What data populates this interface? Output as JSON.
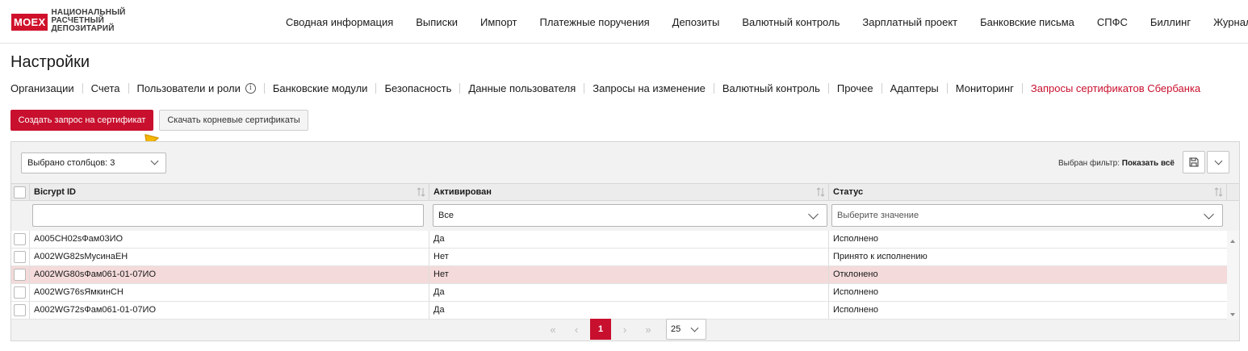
{
  "brand": {
    "logo_mark": "MOEX",
    "logo_line1": "НАЦИОНАЛЬНЫЙ",
    "logo_line2": "РАСЧЕТНЫЙ",
    "logo_line3": "ДЕПОЗИТАРИЙ",
    "accent_color": "#c8102e"
  },
  "nav": {
    "items": [
      {
        "label": "Сводная информация"
      },
      {
        "label": "Выписки"
      },
      {
        "label": "Импорт"
      },
      {
        "label": "Платежные поручения"
      },
      {
        "label": "Депозиты"
      },
      {
        "label": "Валютный контроль"
      },
      {
        "label": "Зарплатный проект"
      },
      {
        "label": "Банковские письма"
      },
      {
        "label": "СПФС"
      },
      {
        "label": "Биллинг"
      },
      {
        "label": "Журнал"
      }
    ]
  },
  "page": {
    "title": "Настройки"
  },
  "subtabs": [
    {
      "label": "Организации"
    },
    {
      "label": "Счета"
    },
    {
      "label": "Пользователи и роли",
      "icon": "info-icon"
    },
    {
      "label": "Банковские модули"
    },
    {
      "label": "Безопасность"
    },
    {
      "label": "Данные пользователя"
    },
    {
      "label": "Запросы на изменение"
    },
    {
      "label": "Валютный контроль"
    },
    {
      "label": "Прочее"
    },
    {
      "label": "Адаптеры"
    },
    {
      "label": "Мониторинг"
    },
    {
      "label": "Запросы сертификатов Сбербанка",
      "active": true
    }
  ],
  "actions": {
    "create_request": "Создать запрос на сертификат",
    "download_root": "Скачать корневые сертификаты"
  },
  "grid": {
    "columns_selected": "Выбрано столбцов: 3",
    "filter_prefix": "Выбран фильтр:",
    "filter_value": "Показать всё",
    "columns": [
      {
        "label": "Bicrypt ID"
      },
      {
        "label": "Активирован"
      },
      {
        "label": "Статус"
      }
    ],
    "filters": {
      "bicrypt_value": "",
      "activated_value": "Все",
      "status_placeholder": "Выберите значение"
    },
    "rows": [
      {
        "bicrypt_id": "A005CH02sФам03ИО",
        "activated": "Да",
        "status": "Исполнено",
        "highlighted": false
      },
      {
        "bicrypt_id": "A002WG82sМусинаЕН",
        "activated": "Нет",
        "status": "Принято к исполнению",
        "highlighted": false
      },
      {
        "bicrypt_id": "A002WG80sФам061-01-07ИО",
        "activated": "Нет",
        "status": "Отклонено",
        "highlighted": true
      },
      {
        "bicrypt_id": "A002WG76sЯмкинСН",
        "activated": "Да",
        "status": "Исполнено",
        "highlighted": false
      },
      {
        "bicrypt_id": "A002WG72sФам061-01-07ИО",
        "activated": "Да",
        "status": "Исполнено",
        "highlighted": false
      }
    ]
  },
  "pagination": {
    "first": "«",
    "prev": "‹",
    "current_page": "1",
    "next": "›",
    "last": "»",
    "page_size": "25"
  }
}
